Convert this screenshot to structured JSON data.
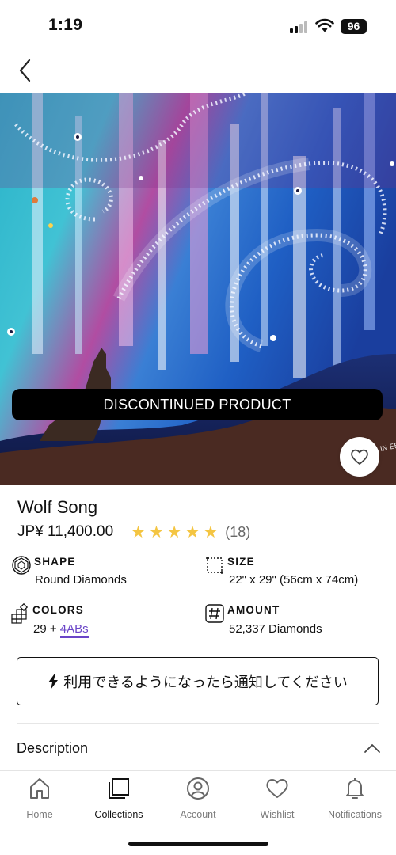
{
  "status_bar": {
    "time": "1:19",
    "battery": "96"
  },
  "nav": {
    "back_icon": "chevron-left-icon"
  },
  "hero": {
    "badge": "DISCONTINUED PRODUCT",
    "wishlist_icon": "heart-icon",
    "signature": "WIN\nEFFY"
  },
  "product": {
    "title": "Wolf Song",
    "price": "JP¥ 11,400.00",
    "rating_stars": 5,
    "review_count": "(18)"
  },
  "specs": {
    "shape": {
      "label": "SHAPE",
      "value": "Round Diamonds",
      "icon": "diamond-shape-icon"
    },
    "size": {
      "label": "SIZE",
      "value": "22\" x 29\" (56cm x 74cm)",
      "icon": "canvas-size-icon"
    },
    "colors": {
      "label": "COLORS",
      "value": "29 + ",
      "ab_link": "4ABs",
      "icon": "color-grid-icon"
    },
    "amount": {
      "label": "AMOUNT",
      "value": "52,337 Diamonds",
      "icon": "hash-icon"
    }
  },
  "notify_button": {
    "label": "利用できるようになったら通知してください",
    "icon": "lightning-icon"
  },
  "description": {
    "title": "Description",
    "toggle_icon": "chevron-up-icon"
  },
  "tab_bar": {
    "tabs": [
      {
        "label": "Home",
        "icon": "home-icon"
      },
      {
        "label": "Collections",
        "icon": "collections-icon"
      },
      {
        "label": "Account",
        "icon": "account-icon"
      },
      {
        "label": "Wishlist",
        "icon": "heart-icon"
      },
      {
        "label": "Notifications",
        "icon": "bell-icon"
      }
    ],
    "active": "Collections"
  },
  "colors": {
    "accent": "#6a45c8",
    "star": "#f4c542",
    "text": "#111111",
    "muted": "#7a7a7a"
  }
}
